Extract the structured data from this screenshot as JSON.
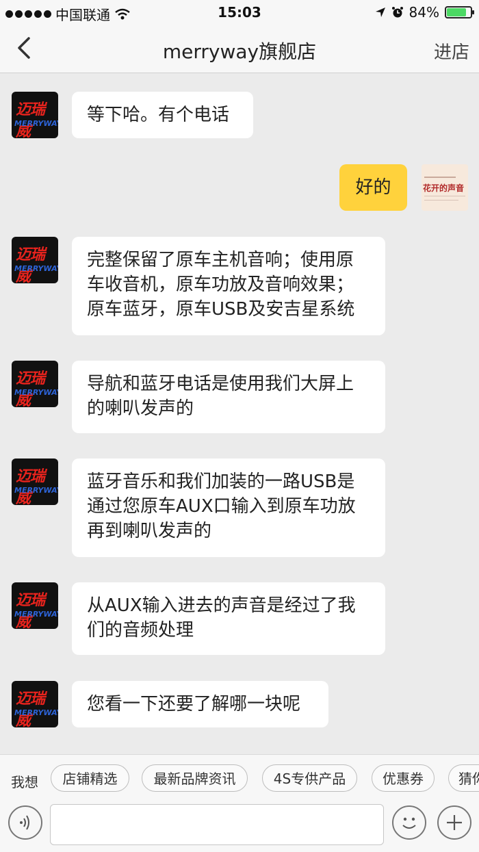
{
  "status_bar": {
    "carrier": "中国联通",
    "time": "15:03",
    "battery": "84%",
    "battery_level": 0.84
  },
  "header": {
    "title": "merryway旗舰店",
    "action": "进店"
  },
  "shop_avatar": {
    "logo_cn": "迈瑞威",
    "logo_en": "MERRYWAY"
  },
  "my_avatar": {
    "text": "花开的声音"
  },
  "messages": [
    {
      "from": "shop",
      "text": "等下哈。有个电话"
    },
    {
      "from": "me",
      "text": "好的"
    },
    {
      "from": "shop",
      "lines": [
        "完整保留了原车主机音响；使用原",
        "车收音机，原车功放及音响效果；",
        "原车蓝牙，原车USB及安吉星系统"
      ]
    },
    {
      "from": "shop",
      "lines": [
        "导航和蓝牙电话是使用我们大屏上",
        "的喇叭发声的"
      ]
    },
    {
      "from": "shop",
      "lines": [
        "蓝牙音乐和我们加装的一路USB是",
        "通过您原车AUX口输入到原车功放",
        "再到喇叭发声的"
      ]
    },
    {
      "from": "shop",
      "lines": [
        "从AUX输入进去的声音是经过了我",
        "们的音频处理"
      ]
    },
    {
      "from": "shop",
      "text": "您看一下还要了解哪一块呢"
    }
  ],
  "quick_bar": {
    "label": "我想",
    "chips": [
      "店铺精选",
      "最新品牌资讯",
      "4S专供产品",
      "优惠券",
      "猜你"
    ]
  },
  "input": {
    "value": "",
    "placeholder": ""
  },
  "icons": {
    "back": "chevron-left-icon",
    "voice": "voice-icon",
    "emoji": "emoji-icon",
    "plus": "plus-icon",
    "wifi": "wifi-icon",
    "location": "location-arrow-icon",
    "alarm": "alarm-icon"
  }
}
